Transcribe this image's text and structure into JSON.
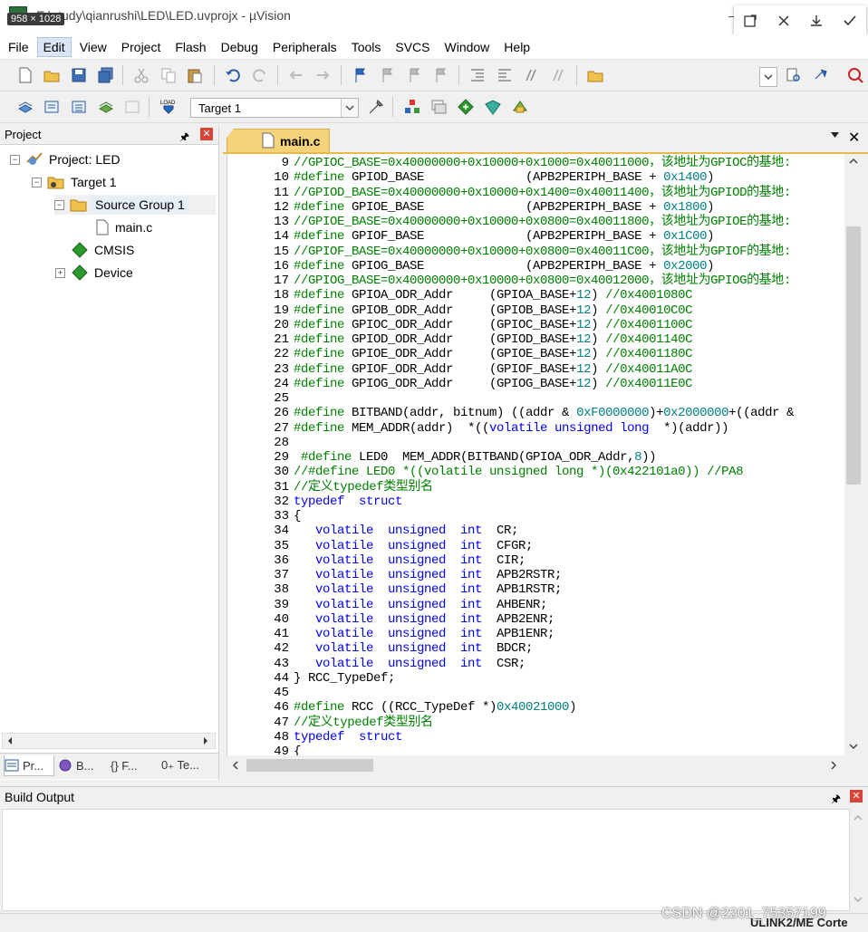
{
  "window": {
    "title": "E:\\study\\qianrushi\\LED\\LED.uvprojx - µVision",
    "dimensions_badge": "958 × 1028"
  },
  "menu": {
    "items": [
      "File",
      "Edit",
      "View",
      "Project",
      "Flash",
      "Debug",
      "Peripherals",
      "Tools",
      "SVCS",
      "Window",
      "Help"
    ],
    "active": "Edit"
  },
  "toolbar2": {
    "target_select_value": "Target 1",
    "load_button_label": "LOAD"
  },
  "project_panel": {
    "title": "Project",
    "tree": {
      "project": "Project: LED",
      "target": "Target 1",
      "group": "Source Group 1",
      "file": "main.c",
      "cmsis": "CMSIS",
      "device": "Device"
    },
    "tabs": [
      "Pr...",
      "B...",
      "{} F...",
      "0₊ Te..."
    ]
  },
  "editor": {
    "tab_label": "main.c",
    "lines": [
      {
        "n": "9",
        "t": [
          [
            "//GPIOC_BASE=0x40000000+0x10000+0x1000=0x40011000，该地址为GPIOC的基地:",
            "k-green"
          ]
        ]
      },
      {
        "n": "10",
        "t": [
          [
            "#define ",
            "k-green"
          ],
          [
            "GPIOD_BASE              (APB2PERIPH_BASE + ",
            ""
          ],
          [
            "0x1400",
            "k-teal"
          ],
          [
            ")",
            ""
          ]
        ]
      },
      {
        "n": "11",
        "t": [
          [
            "//GPIOD_BASE=0x40000000+0x10000+0x1400=0x40011400，该地址为GPIOD的基地:",
            "k-green"
          ]
        ]
      },
      {
        "n": "12",
        "t": [
          [
            "#define ",
            "k-green"
          ],
          [
            "GPIOE_BASE              (APB2PERIPH_BASE + ",
            ""
          ],
          [
            "0x1800",
            "k-teal"
          ],
          [
            ")",
            ""
          ]
        ]
      },
      {
        "n": "13",
        "t": [
          [
            "//GPIOE_BASE=0x40000000+0x10000+0x0800=0x40011800，该地址为GPIOE的基地:",
            "k-green"
          ]
        ]
      },
      {
        "n": "14",
        "t": [
          [
            "#define ",
            "k-green"
          ],
          [
            "GPIOF_BASE              (APB2PERIPH_BASE + ",
            ""
          ],
          [
            "0x1C00",
            "k-teal"
          ],
          [
            ")",
            ""
          ]
        ]
      },
      {
        "n": "15",
        "t": [
          [
            "//GPIOF_BASE=0x40000000+0x10000+0x0800=0x40011C00，该地址为GPIOF的基地:",
            "k-green"
          ]
        ]
      },
      {
        "n": "16",
        "t": [
          [
            "#define ",
            "k-green"
          ],
          [
            "GPIOG_BASE              (APB2PERIPH_BASE + ",
            ""
          ],
          [
            "0x2000",
            "k-teal"
          ],
          [
            ")",
            ""
          ]
        ]
      },
      {
        "n": "17",
        "t": [
          [
            "//GPIOG_BASE=0x40000000+0x10000+0x0800=0x40012000，该地址为GPIOG的基地:",
            "k-green"
          ]
        ]
      },
      {
        "n": "18",
        "t": [
          [
            "#define ",
            "k-green"
          ],
          [
            "GPIOA_ODR_Addr     (GPIOA_BASE+",
            ""
          ],
          [
            "12",
            "k-teal"
          ],
          [
            ") ",
            ""
          ],
          [
            "//0x4001080C",
            "k-green"
          ]
        ]
      },
      {
        "n": "19",
        "t": [
          [
            "#define ",
            "k-green"
          ],
          [
            "GPIOB_ODR_Addr     (GPIOB_BASE+",
            ""
          ],
          [
            "12",
            "k-teal"
          ],
          [
            ") ",
            ""
          ],
          [
            "//0x40010C0C",
            "k-green"
          ]
        ]
      },
      {
        "n": "20",
        "t": [
          [
            "#define ",
            "k-green"
          ],
          [
            "GPIOC_ODR_Addr     (GPIOC_BASE+",
            ""
          ],
          [
            "12",
            "k-teal"
          ],
          [
            ") ",
            ""
          ],
          [
            "//0x4001100C",
            "k-green"
          ]
        ]
      },
      {
        "n": "21",
        "t": [
          [
            "#define ",
            "k-green"
          ],
          [
            "GPIOD_ODR_Addr     (GPIOD_BASE+",
            ""
          ],
          [
            "12",
            "k-teal"
          ],
          [
            ") ",
            ""
          ],
          [
            "//0x4001140C",
            "k-green"
          ]
        ]
      },
      {
        "n": "22",
        "t": [
          [
            "#define ",
            "k-green"
          ],
          [
            "GPIOE_ODR_Addr     (GPIOE_BASE+",
            ""
          ],
          [
            "12",
            "k-teal"
          ],
          [
            ") ",
            ""
          ],
          [
            "//0x4001180C",
            "k-green"
          ]
        ]
      },
      {
        "n": "23",
        "t": [
          [
            "#define ",
            "k-green"
          ],
          [
            "GPIOF_ODR_Addr     (GPIOF_BASE+",
            ""
          ],
          [
            "12",
            "k-teal"
          ],
          [
            ") ",
            ""
          ],
          [
            "//0x40011A0C",
            "k-green"
          ]
        ]
      },
      {
        "n": "24",
        "t": [
          [
            "#define ",
            "k-green"
          ],
          [
            "GPIOG_ODR_Addr     (GPIOG_BASE+",
            ""
          ],
          [
            "12",
            "k-teal"
          ],
          [
            ") ",
            ""
          ],
          [
            "//0x40011E0C",
            "k-green"
          ]
        ]
      },
      {
        "n": "25",
        "t": [
          [
            "",
            ""
          ]
        ]
      },
      {
        "n": "26",
        "t": [
          [
            "#define ",
            "k-green"
          ],
          [
            "BITBAND(addr, bitnum) ((addr & ",
            ""
          ],
          [
            "0xF0000000",
            "k-teal"
          ],
          [
            ")+",
            ""
          ],
          [
            "0x2000000",
            "k-teal"
          ],
          [
            "+((addr &",
            ""
          ]
        ]
      },
      {
        "n": "27",
        "t": [
          [
            "#define ",
            "k-green"
          ],
          [
            "MEM_ADDR(addr)  *((",
            ""
          ],
          [
            "volatile unsigned long",
            "k-blue"
          ],
          [
            "  *)(addr))",
            ""
          ]
        ]
      },
      {
        "n": "28",
        "t": [
          [
            "",
            ""
          ]
        ]
      },
      {
        "n": "29",
        "t": [
          [
            " #define ",
            "k-green"
          ],
          [
            "LED0  MEM_ADDR(BITBAND(GPIOA_ODR_Addr,",
            ""
          ],
          [
            "8",
            "k-teal"
          ],
          [
            "))",
            ""
          ]
        ]
      },
      {
        "n": "30",
        "t": [
          [
            "//#define LED0 *((volatile unsigned long *)(0x422101a0)) //PA8",
            "k-green"
          ]
        ]
      },
      {
        "n": "31",
        "t": [
          [
            "//定义typedef类型别名",
            "k-green"
          ]
        ]
      },
      {
        "n": "32",
        "t": [
          [
            "typedef  struct",
            "k-blue"
          ]
        ]
      },
      {
        "n": "33",
        "t": [
          [
            "{",
            ""
          ]
        ]
      },
      {
        "n": "34",
        "t": [
          [
            "   volatile  unsigned  int",
            "k-blue"
          ],
          [
            "  CR;",
            ""
          ]
        ]
      },
      {
        "n": "35",
        "t": [
          [
            "   volatile  unsigned  int",
            "k-blue"
          ],
          [
            "  CFGR;",
            ""
          ]
        ]
      },
      {
        "n": "36",
        "t": [
          [
            "   volatile  unsigned  int",
            "k-blue"
          ],
          [
            "  CIR;",
            ""
          ]
        ]
      },
      {
        "n": "37",
        "t": [
          [
            "   volatile  unsigned  int",
            "k-blue"
          ],
          [
            "  APB2RSTR;",
            ""
          ]
        ]
      },
      {
        "n": "38",
        "t": [
          [
            "   volatile  unsigned  int",
            "k-blue"
          ],
          [
            "  APB1RSTR;",
            ""
          ]
        ]
      },
      {
        "n": "39",
        "t": [
          [
            "   volatile  unsigned  int",
            "k-blue"
          ],
          [
            "  AHBENR;",
            ""
          ]
        ]
      },
      {
        "n": "40",
        "t": [
          [
            "   volatile  unsigned  int",
            "k-blue"
          ],
          [
            "  APB2ENR;",
            ""
          ]
        ]
      },
      {
        "n": "41",
        "t": [
          [
            "   volatile  unsigned  int",
            "k-blue"
          ],
          [
            "  APB1ENR;",
            ""
          ]
        ]
      },
      {
        "n": "42",
        "t": [
          [
            "   volatile  unsigned  int",
            "k-blue"
          ],
          [
            "  BDCR;",
            ""
          ]
        ]
      },
      {
        "n": "43",
        "t": [
          [
            "   volatile  unsigned  int",
            "k-blue"
          ],
          [
            "  CSR;",
            ""
          ]
        ]
      },
      {
        "n": "44",
        "t": [
          [
            "} RCC_TypeDef;",
            ""
          ]
        ]
      },
      {
        "n": "45",
        "t": [
          [
            "",
            ""
          ]
        ]
      },
      {
        "n": "46",
        "t": [
          [
            "#define ",
            "k-green"
          ],
          [
            "RCC ((RCC_TypeDef *)",
            ""
          ],
          [
            "0x40021000",
            "k-teal"
          ],
          [
            ")",
            ""
          ]
        ]
      },
      {
        "n": "47",
        "t": [
          [
            "//定义typedef类型别名",
            "k-green"
          ]
        ]
      },
      {
        "n": "48",
        "t": [
          [
            "typedef  struct",
            "k-blue"
          ]
        ]
      },
      {
        "n": "49",
        "t": [
          [
            "{",
            ""
          ]
        ]
      }
    ]
  },
  "build_output": {
    "title": "Build Output"
  },
  "statusbar": {
    "debugger": "ULINK2/ME Corte"
  },
  "watermark": "CSDN @2201_75357199",
  "colors": {
    "tab_active": "#f5d37a",
    "comment": "#008000",
    "keyword": "#0000ff",
    "number": "#008080",
    "close_red": "#d9443a"
  }
}
